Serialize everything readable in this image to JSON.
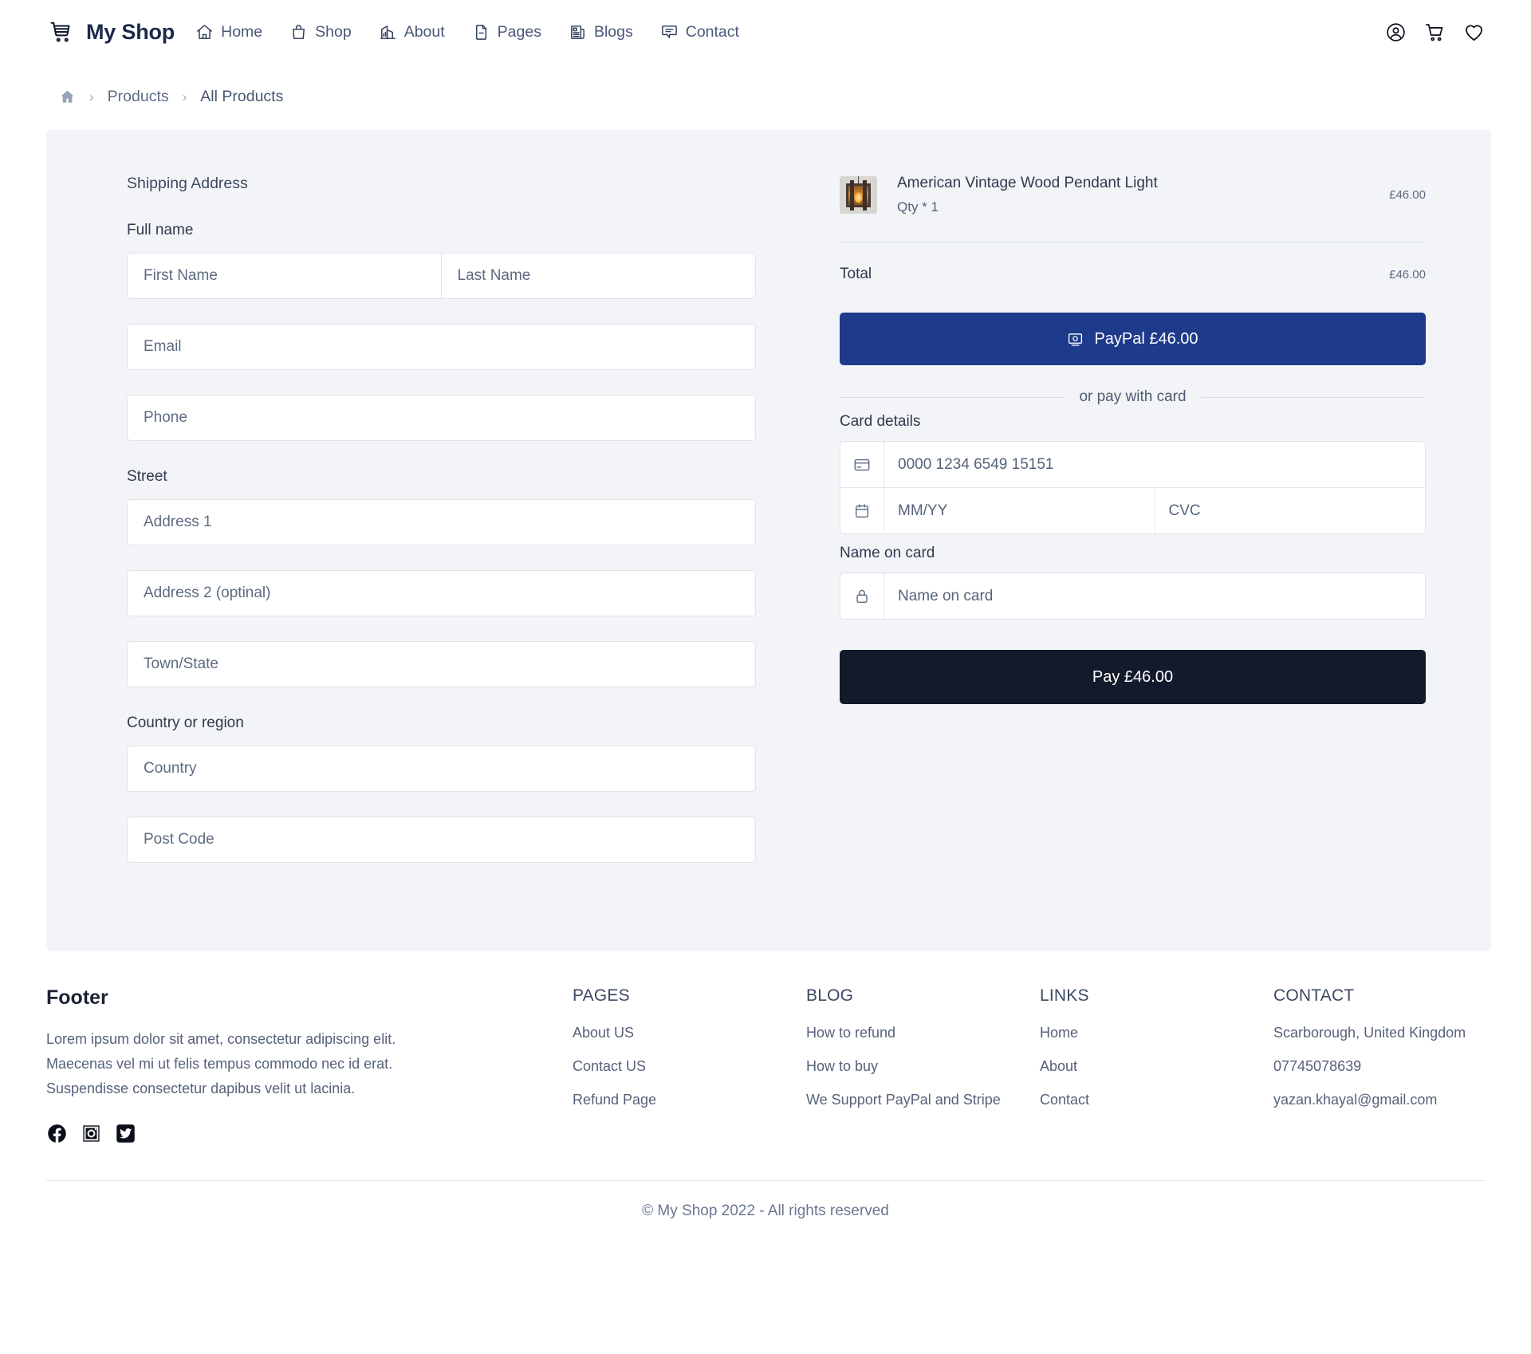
{
  "navbar": {
    "brand": "My Shop",
    "logo_icon": "shopping-cart-icon",
    "links": [
      {
        "label": "Home",
        "icon": "house-icon"
      },
      {
        "label": "Shop",
        "icon": "shopping-bag-icon"
      },
      {
        "label": "About",
        "icon": "buildings-chart-icon"
      },
      {
        "label": "Pages",
        "icon": "file-minus-icon"
      },
      {
        "label": "Blogs",
        "icon": "newspaper-icon"
      },
      {
        "label": "Contact",
        "icon": "chat-bubble-icon"
      }
    ],
    "actions": [
      {
        "icon": "user-circle-icon"
      },
      {
        "icon": "shopping-cart-icon"
      },
      {
        "icon": "heart-icon"
      }
    ]
  },
  "breadcrumb": {
    "home_icon": "home-icon",
    "separator": "›",
    "items": [
      {
        "label": "Products"
      },
      {
        "label": "All Products"
      }
    ]
  },
  "shipping": {
    "title": "Shipping Address",
    "full_name_label": "Full name",
    "first_name_placeholder": "First Name",
    "last_name_placeholder": "Last Name",
    "email_placeholder": "Email",
    "phone_placeholder": "Phone",
    "street_label": "Street",
    "address1_placeholder": "Address 1",
    "address2_placeholder": "Address 2 (optinal)",
    "town_placeholder": "Town/State",
    "country_label": "Country or region",
    "country_placeholder": "Country",
    "postcode_placeholder": "Post Code"
  },
  "order": {
    "item": {
      "name": "American Vintage Wood Pendant Light",
      "qty": "Qty * 1",
      "price": "£46.00",
      "thumbnail_icon": "pendant-lamp-thumbnail"
    },
    "total_label": "Total",
    "total_value": "£46.00"
  },
  "payment": {
    "paypal_button": "PayPal £46.00",
    "paypal_icon": "paypal-icon",
    "divider": "or pay with card",
    "card_details_label": "Card details",
    "card_number_placeholder": "0000 1234 6549 15151",
    "card_number_icon": "credit-card-icon",
    "expiry_placeholder": "MM/YY",
    "expiry_icon": "calendar-icon",
    "cvc_placeholder": "CVC",
    "name_on_card_label": "Name on card",
    "name_on_card_placeholder": "Name on card",
    "name_on_card_icon": "lock-icon",
    "pay_button": "Pay £46.00"
  },
  "footer": {
    "title": "Footer",
    "description": "Lorem ipsum dolor sit amet, consectetur adipiscing elit. Maecenas vel mi ut felis tempus commodo nec id erat. Suspendisse consectetur dapibus velit ut lacinia.",
    "social": [
      {
        "icon": "facebook-icon"
      },
      {
        "icon": "instagram-icon"
      },
      {
        "icon": "twitter-icon"
      }
    ],
    "columns": [
      {
        "heading": "PAGES",
        "links": [
          "About US",
          "Contact US",
          "Refund Page"
        ]
      },
      {
        "heading": "BLOG",
        "links": [
          "How to refund",
          "How to buy",
          "We Support PayPal and Stripe"
        ]
      },
      {
        "heading": "LINKS",
        "links": [
          "Home",
          "About",
          "Contact"
        ]
      }
    ],
    "contact": {
      "heading": "CONTACT",
      "lines": [
        "Scarborough, United Kingdom",
        "07745078639",
        "yazan.khayal@gmail.com"
      ]
    },
    "copyright": "© My Shop 2022 - All rights reserved"
  },
  "colors": {
    "panel_bg": "#f2f4f7",
    "paypal_blue": "#1e3a8a",
    "pay_dark": "#131a2b",
    "brand_navy": "#1b2a4a"
  }
}
